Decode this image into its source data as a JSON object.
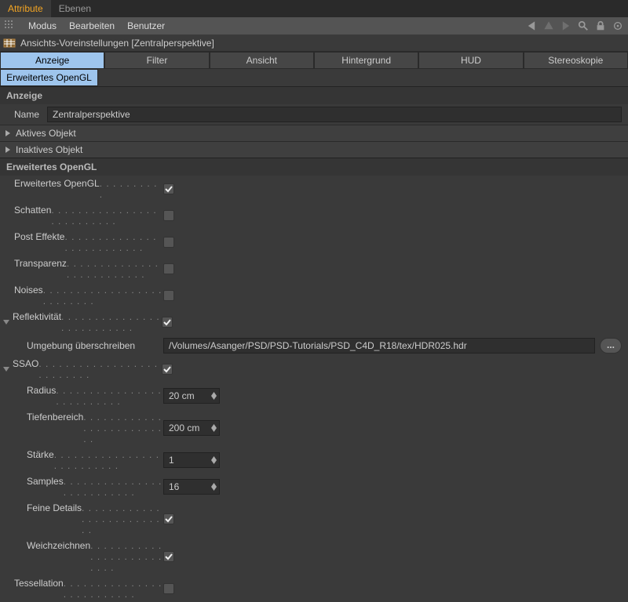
{
  "top_tabs": {
    "attribute": "Attribute",
    "ebenen": "Ebenen"
  },
  "menu": {
    "modus": "Modus",
    "bearbeiten": "Bearbeiten",
    "benutzer": "Benutzer"
  },
  "header": {
    "title": "Ansichts-Voreinstellungen [Zentralperspektive]"
  },
  "cat_tabs": {
    "anzeige": "Anzeige",
    "filter": "Filter",
    "ansicht": "Ansicht",
    "hintergrund": "Hintergrund",
    "hud": "HUD",
    "stereoskopie": "Stereoskopie",
    "erweitertes_opengl": "Erweitertes OpenGL"
  },
  "sections": {
    "anzeige": "Anzeige",
    "aktives_objekt": "Aktives Objekt",
    "inaktives_objekt": "Inaktives Objekt",
    "erweitertes_opengl": "Erweitertes OpenGL"
  },
  "fields": {
    "name_label": "Name",
    "name_value": "Zentralperspektive",
    "erweitertes_opengl": "Erweitertes OpenGL",
    "schatten": "Schatten",
    "post_effekte": "Post Effekte",
    "transparenz": "Transparenz",
    "noises": "Noises",
    "reflektivitaet": "Reflektivität",
    "umgebung_label": "Umgebung überschreiben",
    "umgebung_value": "/Volumes/Asanger/PSD/PSD-Tutorials/PSD_C4D_R18/tex/HDR025.hdr",
    "ssao": "SSAO",
    "radius_label": "Radius",
    "radius_value": "20 cm",
    "tiefenbereich_label": "Tiefenbereich",
    "tiefenbereich_value": "200 cm",
    "staerke_label": "Stärke",
    "staerke_value": "1",
    "samples_label": "Samples",
    "samples_value": "16",
    "feine_details": "Feine Details",
    "weichzeichnen": "Weichzeichnen",
    "tessellation": "Tessellation",
    "browse": "..."
  },
  "dots": ". . . . . . . . . . . . . . . . . . . . . . . . . .",
  "dots_short": ". . . . . . . . . ."
}
